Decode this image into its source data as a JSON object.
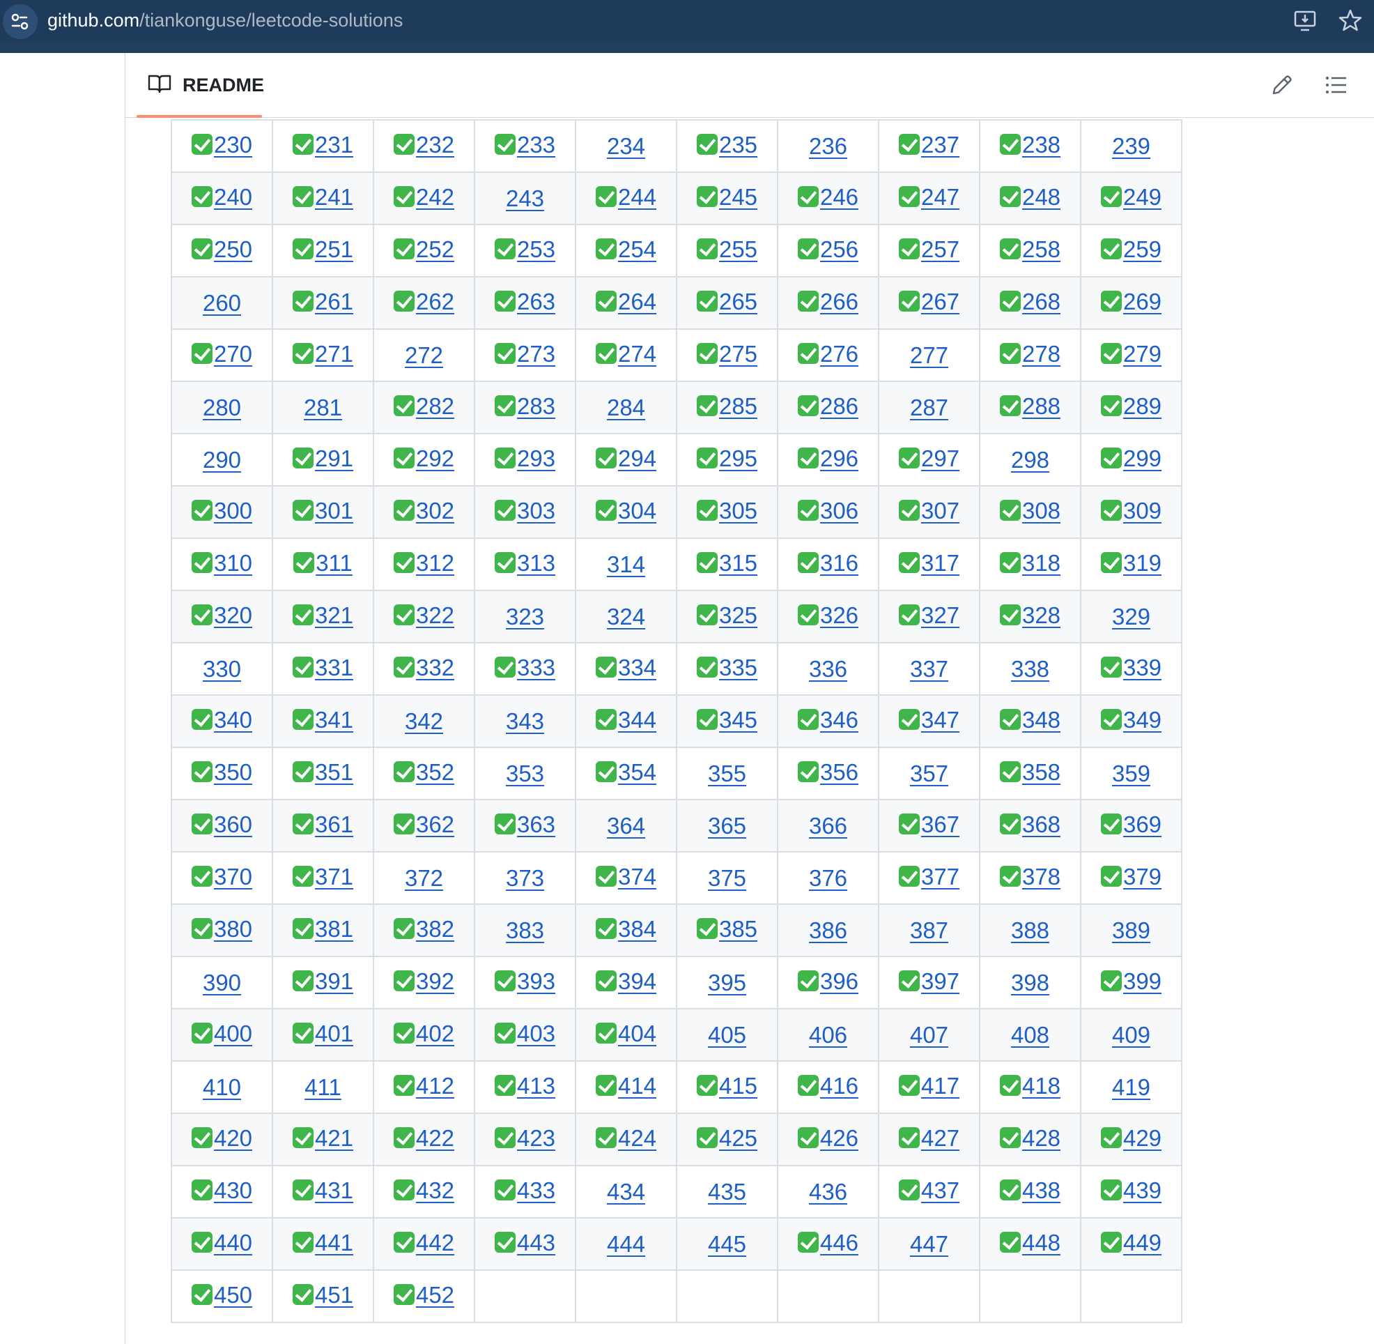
{
  "browser": {
    "url_host": "github.com",
    "url_path": "/tiankonguse/leetcode-solutions",
    "icons": [
      "site-settings-icon",
      "install-app-icon",
      "bookmark-star-icon"
    ]
  },
  "readme": {
    "tab_label": "README",
    "icons": [
      "book-icon",
      "edit-pencil-icon",
      "outline-list-icon"
    ]
  },
  "problems": {
    "columns": 10,
    "check_color": "#3fb54a",
    "link_color": "#1f5fc5",
    "items": [
      {
        "n": "230",
        "done": true
      },
      {
        "n": "231",
        "done": true
      },
      {
        "n": "232",
        "done": true
      },
      {
        "n": "233",
        "done": true
      },
      {
        "n": "234",
        "done": false
      },
      {
        "n": "235",
        "done": true
      },
      {
        "n": "236",
        "done": false
      },
      {
        "n": "237",
        "done": true
      },
      {
        "n": "238",
        "done": true
      },
      {
        "n": "239",
        "done": false
      },
      {
        "n": "240",
        "done": true
      },
      {
        "n": "241",
        "done": true
      },
      {
        "n": "242",
        "done": true
      },
      {
        "n": "243",
        "done": false
      },
      {
        "n": "244",
        "done": true
      },
      {
        "n": "245",
        "done": true
      },
      {
        "n": "246",
        "done": true
      },
      {
        "n": "247",
        "done": true
      },
      {
        "n": "248",
        "done": true
      },
      {
        "n": "249",
        "done": true
      },
      {
        "n": "250",
        "done": true
      },
      {
        "n": "251",
        "done": true
      },
      {
        "n": "252",
        "done": true
      },
      {
        "n": "253",
        "done": true
      },
      {
        "n": "254",
        "done": true
      },
      {
        "n": "255",
        "done": true
      },
      {
        "n": "256",
        "done": true
      },
      {
        "n": "257",
        "done": true
      },
      {
        "n": "258",
        "done": true
      },
      {
        "n": "259",
        "done": true
      },
      {
        "n": "260",
        "done": false
      },
      {
        "n": "261",
        "done": true
      },
      {
        "n": "262",
        "done": true
      },
      {
        "n": "263",
        "done": true
      },
      {
        "n": "264",
        "done": true
      },
      {
        "n": "265",
        "done": true
      },
      {
        "n": "266",
        "done": true
      },
      {
        "n": "267",
        "done": true
      },
      {
        "n": "268",
        "done": true
      },
      {
        "n": "269",
        "done": true
      },
      {
        "n": "270",
        "done": true
      },
      {
        "n": "271",
        "done": true
      },
      {
        "n": "272",
        "done": false
      },
      {
        "n": "273",
        "done": true
      },
      {
        "n": "274",
        "done": true
      },
      {
        "n": "275",
        "done": true
      },
      {
        "n": "276",
        "done": true
      },
      {
        "n": "277",
        "done": false
      },
      {
        "n": "278",
        "done": true
      },
      {
        "n": "279",
        "done": true
      },
      {
        "n": "280",
        "done": false
      },
      {
        "n": "281",
        "done": false
      },
      {
        "n": "282",
        "done": true
      },
      {
        "n": "283",
        "done": true
      },
      {
        "n": "284",
        "done": false
      },
      {
        "n": "285",
        "done": true
      },
      {
        "n": "286",
        "done": true
      },
      {
        "n": "287",
        "done": false
      },
      {
        "n": "288",
        "done": true
      },
      {
        "n": "289",
        "done": true
      },
      {
        "n": "290",
        "done": false
      },
      {
        "n": "291",
        "done": true
      },
      {
        "n": "292",
        "done": true
      },
      {
        "n": "293",
        "done": true
      },
      {
        "n": "294",
        "done": true
      },
      {
        "n": "295",
        "done": true
      },
      {
        "n": "296",
        "done": true
      },
      {
        "n": "297",
        "done": true
      },
      {
        "n": "298",
        "done": false
      },
      {
        "n": "299",
        "done": true
      },
      {
        "n": "300",
        "done": true
      },
      {
        "n": "301",
        "done": true
      },
      {
        "n": "302",
        "done": true
      },
      {
        "n": "303",
        "done": true
      },
      {
        "n": "304",
        "done": true
      },
      {
        "n": "305",
        "done": true
      },
      {
        "n": "306",
        "done": true
      },
      {
        "n": "307",
        "done": true
      },
      {
        "n": "308",
        "done": true
      },
      {
        "n": "309",
        "done": true
      },
      {
        "n": "310",
        "done": true
      },
      {
        "n": "311",
        "done": true
      },
      {
        "n": "312",
        "done": true
      },
      {
        "n": "313",
        "done": true
      },
      {
        "n": "314",
        "done": false
      },
      {
        "n": "315",
        "done": true
      },
      {
        "n": "316",
        "done": true
      },
      {
        "n": "317",
        "done": true
      },
      {
        "n": "318",
        "done": true
      },
      {
        "n": "319",
        "done": true
      },
      {
        "n": "320",
        "done": true
      },
      {
        "n": "321",
        "done": true
      },
      {
        "n": "322",
        "done": true
      },
      {
        "n": "323",
        "done": false
      },
      {
        "n": "324",
        "done": false
      },
      {
        "n": "325",
        "done": true
      },
      {
        "n": "326",
        "done": true
      },
      {
        "n": "327",
        "done": true
      },
      {
        "n": "328",
        "done": true
      },
      {
        "n": "329",
        "done": false
      },
      {
        "n": "330",
        "done": false
      },
      {
        "n": "331",
        "done": true
      },
      {
        "n": "332",
        "done": true
      },
      {
        "n": "333",
        "done": true
      },
      {
        "n": "334",
        "done": true
      },
      {
        "n": "335",
        "done": true
      },
      {
        "n": "336",
        "done": false
      },
      {
        "n": "337",
        "done": false
      },
      {
        "n": "338",
        "done": false
      },
      {
        "n": "339",
        "done": true
      },
      {
        "n": "340",
        "done": true
      },
      {
        "n": "341",
        "done": true
      },
      {
        "n": "342",
        "done": false
      },
      {
        "n": "343",
        "done": false
      },
      {
        "n": "344",
        "done": true
      },
      {
        "n": "345",
        "done": true
      },
      {
        "n": "346",
        "done": true
      },
      {
        "n": "347",
        "done": true
      },
      {
        "n": "348",
        "done": true
      },
      {
        "n": "349",
        "done": true
      },
      {
        "n": "350",
        "done": true
      },
      {
        "n": "351",
        "done": true
      },
      {
        "n": "352",
        "done": true
      },
      {
        "n": "353",
        "done": false
      },
      {
        "n": "354",
        "done": true
      },
      {
        "n": "355",
        "done": false
      },
      {
        "n": "356",
        "done": true
      },
      {
        "n": "357",
        "done": false
      },
      {
        "n": "358",
        "done": true
      },
      {
        "n": "359",
        "done": false
      },
      {
        "n": "360",
        "done": true
      },
      {
        "n": "361",
        "done": true
      },
      {
        "n": "362",
        "done": true
      },
      {
        "n": "363",
        "done": true
      },
      {
        "n": "364",
        "done": false
      },
      {
        "n": "365",
        "done": false
      },
      {
        "n": "366",
        "done": false
      },
      {
        "n": "367",
        "done": true
      },
      {
        "n": "368",
        "done": true
      },
      {
        "n": "369",
        "done": true
      },
      {
        "n": "370",
        "done": true
      },
      {
        "n": "371",
        "done": true
      },
      {
        "n": "372",
        "done": false
      },
      {
        "n": "373",
        "done": false
      },
      {
        "n": "374",
        "done": true
      },
      {
        "n": "375",
        "done": false
      },
      {
        "n": "376",
        "done": false
      },
      {
        "n": "377",
        "done": true
      },
      {
        "n": "378",
        "done": true
      },
      {
        "n": "379",
        "done": true
      },
      {
        "n": "380",
        "done": true
      },
      {
        "n": "381",
        "done": true
      },
      {
        "n": "382",
        "done": true
      },
      {
        "n": "383",
        "done": false
      },
      {
        "n": "384",
        "done": true
      },
      {
        "n": "385",
        "done": true
      },
      {
        "n": "386",
        "done": false
      },
      {
        "n": "387",
        "done": false
      },
      {
        "n": "388",
        "done": false
      },
      {
        "n": "389",
        "done": false
      },
      {
        "n": "390",
        "done": false
      },
      {
        "n": "391",
        "done": true
      },
      {
        "n": "392",
        "done": true
      },
      {
        "n": "393",
        "done": true
      },
      {
        "n": "394",
        "done": true
      },
      {
        "n": "395",
        "done": false
      },
      {
        "n": "396",
        "done": true
      },
      {
        "n": "397",
        "done": true
      },
      {
        "n": "398",
        "done": false
      },
      {
        "n": "399",
        "done": true
      },
      {
        "n": "400",
        "done": true
      },
      {
        "n": "401",
        "done": true
      },
      {
        "n": "402",
        "done": true
      },
      {
        "n": "403",
        "done": true
      },
      {
        "n": "404",
        "done": true
      },
      {
        "n": "405",
        "done": false
      },
      {
        "n": "406",
        "done": false
      },
      {
        "n": "407",
        "done": false
      },
      {
        "n": "408",
        "done": false
      },
      {
        "n": "409",
        "done": false
      },
      {
        "n": "410",
        "done": false
      },
      {
        "n": "411",
        "done": false
      },
      {
        "n": "412",
        "done": true
      },
      {
        "n": "413",
        "done": true
      },
      {
        "n": "414",
        "done": true
      },
      {
        "n": "415",
        "done": true
      },
      {
        "n": "416",
        "done": true
      },
      {
        "n": "417",
        "done": true
      },
      {
        "n": "418",
        "done": true
      },
      {
        "n": "419",
        "done": false
      },
      {
        "n": "420",
        "done": true
      },
      {
        "n": "421",
        "done": true
      },
      {
        "n": "422",
        "done": true
      },
      {
        "n": "423",
        "done": true
      },
      {
        "n": "424",
        "done": true
      },
      {
        "n": "425",
        "done": true
      },
      {
        "n": "426",
        "done": true
      },
      {
        "n": "427",
        "done": true
      },
      {
        "n": "428",
        "done": true
      },
      {
        "n": "429",
        "done": true
      },
      {
        "n": "430",
        "done": true
      },
      {
        "n": "431",
        "done": true
      },
      {
        "n": "432",
        "done": true
      },
      {
        "n": "433",
        "done": true
      },
      {
        "n": "434",
        "done": false
      },
      {
        "n": "435",
        "done": false
      },
      {
        "n": "436",
        "done": false
      },
      {
        "n": "437",
        "done": true
      },
      {
        "n": "438",
        "done": true
      },
      {
        "n": "439",
        "done": true
      },
      {
        "n": "440",
        "done": true
      },
      {
        "n": "441",
        "done": true
      },
      {
        "n": "442",
        "done": true
      },
      {
        "n": "443",
        "done": true
      },
      {
        "n": "444",
        "done": false
      },
      {
        "n": "445",
        "done": false
      },
      {
        "n": "446",
        "done": true
      },
      {
        "n": "447",
        "done": false
      },
      {
        "n": "448",
        "done": true
      },
      {
        "n": "449",
        "done": true
      },
      {
        "n": "450",
        "done": true
      },
      {
        "n": "451",
        "done": true
      },
      {
        "n": "452",
        "done": true
      }
    ]
  }
}
